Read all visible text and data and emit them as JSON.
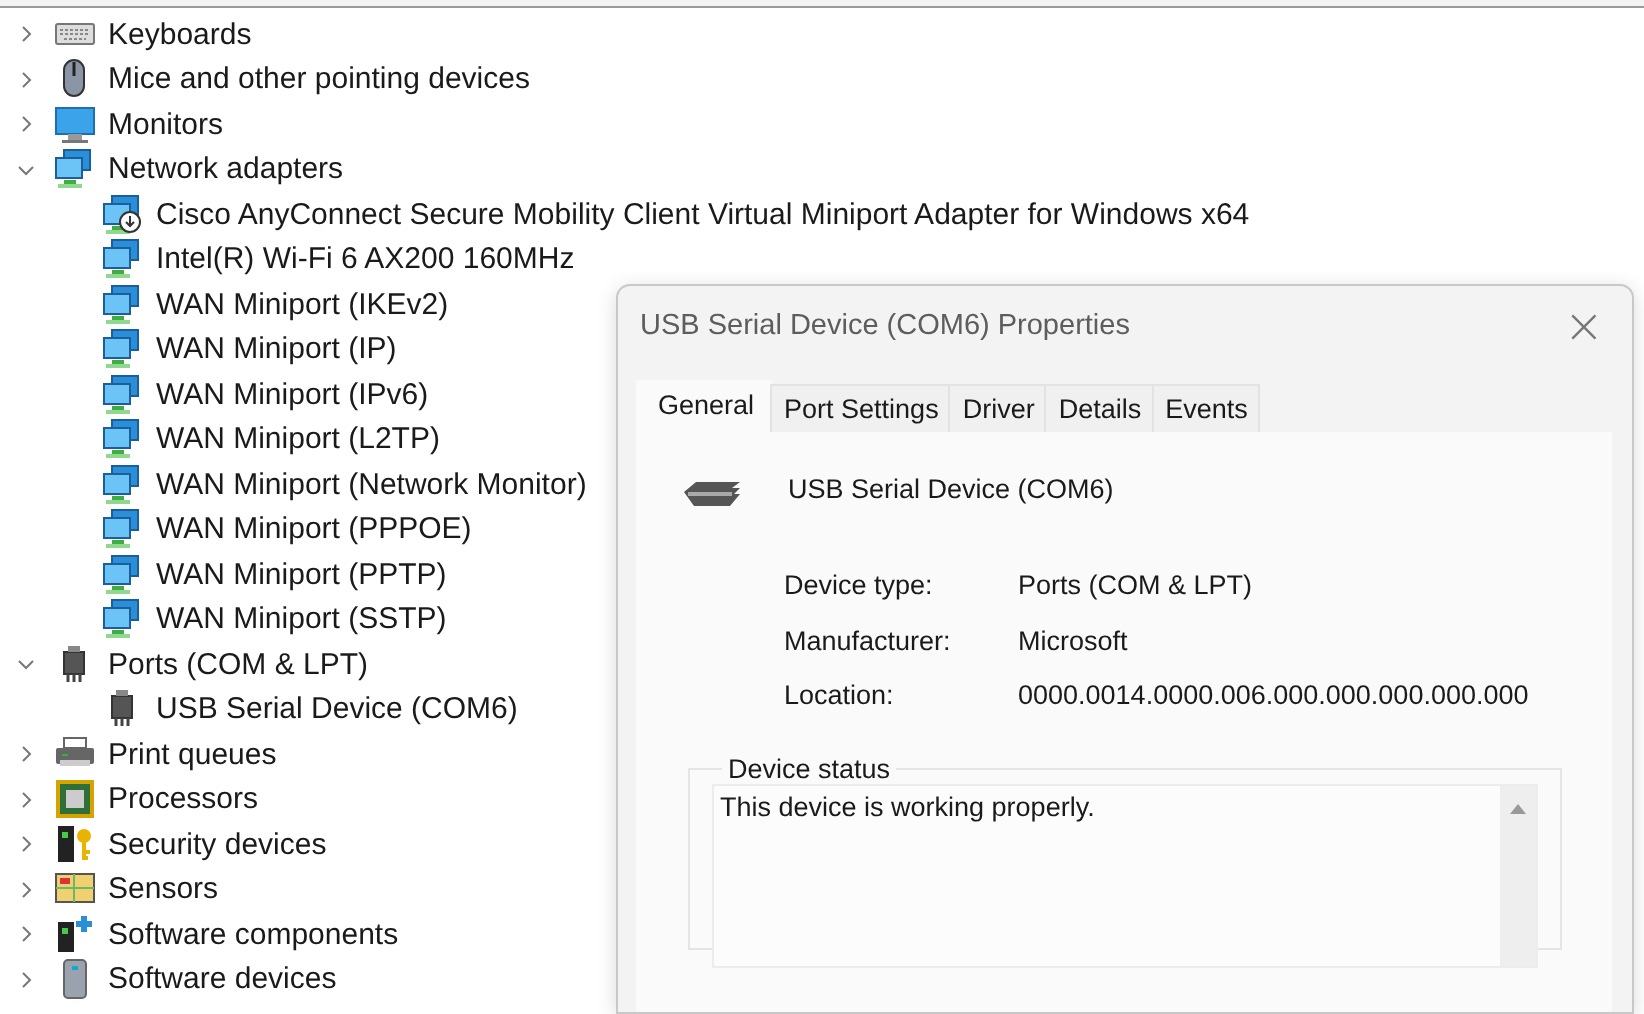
{
  "tree": [
    {
      "label": "Keyboards",
      "expanded": false
    },
    {
      "label": "Mice and other pointing devices",
      "expanded": false
    },
    {
      "label": "Monitors",
      "expanded": false
    },
    {
      "label": "Network adapters",
      "expanded": true,
      "children": [
        {
          "label": "Cisco AnyConnect Secure Mobility Client Virtual Miniport Adapter for Windows x64"
        },
        {
          "label": "Intel(R) Wi-Fi 6 AX200 160MHz"
        },
        {
          "label": "WAN Miniport (IKEv2)"
        },
        {
          "label": "WAN Miniport (IP)"
        },
        {
          "label": "WAN Miniport (IPv6)"
        },
        {
          "label": "WAN Miniport (L2TP)"
        },
        {
          "label": "WAN Miniport (Network Monitor)"
        },
        {
          "label": "WAN Miniport (PPPOE)"
        },
        {
          "label": "WAN Miniport (PPTP)"
        },
        {
          "label": "WAN Miniport (SSTP)"
        }
      ]
    },
    {
      "label": "Ports (COM & LPT)",
      "expanded": true,
      "children": [
        {
          "label": "USB Serial Device (COM6)"
        }
      ]
    },
    {
      "label": "Print queues",
      "expanded": false
    },
    {
      "label": "Processors",
      "expanded": false
    },
    {
      "label": "Security devices",
      "expanded": false
    },
    {
      "label": "Sensors",
      "expanded": false
    },
    {
      "label": "Software components",
      "expanded": false
    },
    {
      "label": "Software devices",
      "expanded": false
    }
  ],
  "dialog": {
    "title": "USB Serial Device (COM6) Properties",
    "close": "×",
    "tabs": [
      {
        "label": "General",
        "selected": true
      },
      {
        "label": "Port Settings",
        "selected": false
      },
      {
        "label": "Driver",
        "selected": false
      },
      {
        "label": "Details",
        "selected": false
      },
      {
        "label": "Events",
        "selected": false
      }
    ],
    "device_name": "USB Serial Device (COM6)",
    "properties": [
      {
        "label": "Device type:",
        "value": "Ports (COM & LPT)"
      },
      {
        "label": "Manufacturer:",
        "value": "Microsoft"
      },
      {
        "label": "Location:",
        "value": "0000.0014.0000.006.000.000.000.000.000"
      }
    ],
    "status_group": "Device status",
    "status_text": "This device is working properly."
  }
}
